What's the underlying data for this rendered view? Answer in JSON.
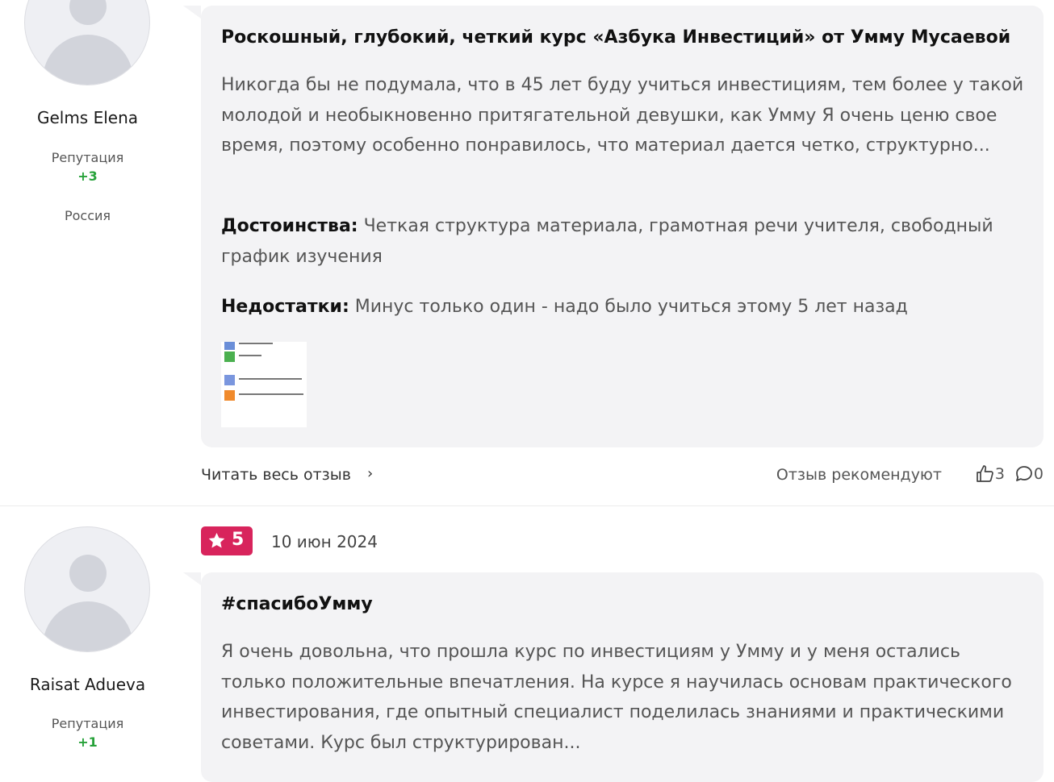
{
  "colors": {
    "badge": "#d8245c",
    "reputation_positive": "#27a23a",
    "bubble_bg": "#f3f3f5"
  },
  "reviews": [
    {
      "author": "Gelms Elena",
      "reputation_label": "Репутация",
      "reputation": "+3",
      "country": "Россия",
      "title": "Роскошный, глубокий, четкий курс «Азбука Инвестиций» от Умму Мусаевой",
      "text": "Никогда бы не подумала, что в 45 лет буду учиться инвестициям, тем более у такой молодой и необыкновенно притягательной девушки, как Умму Я очень ценю свое время, поэтому особенно понравилось, что материал дается четко, структурно...",
      "pros_label": "Достоинства:",
      "pros": "Четкая структура материала, грамотная речи учителя, свободный график изучения",
      "cons_label": "Недостатки:",
      "cons": "Минус только один - надо было учиться этому 5 лет назад",
      "read_more": "Читать весь отзыв",
      "recommend": "Отзыв рекомендуют",
      "likes": "3",
      "comments": "0",
      "thumbnail_icons": [
        "blue-icon",
        "green-icon",
        "blue-icon",
        "orange-icon"
      ]
    },
    {
      "author": "Raisat Adueva",
      "reputation_label": "Репутация",
      "reputation": "+1",
      "rating": "5",
      "date": "10 июн 2024",
      "title": "#спасибоУмму",
      "text": "Я очень довольна, что прошла курс по инвестициям у Умму и у меня остались только положительные впечатления. На курсе я научилась основам практического инвестирования, где опытный специалист поделилась знаниями и практическими советами. Курс был структурирован..."
    }
  ]
}
